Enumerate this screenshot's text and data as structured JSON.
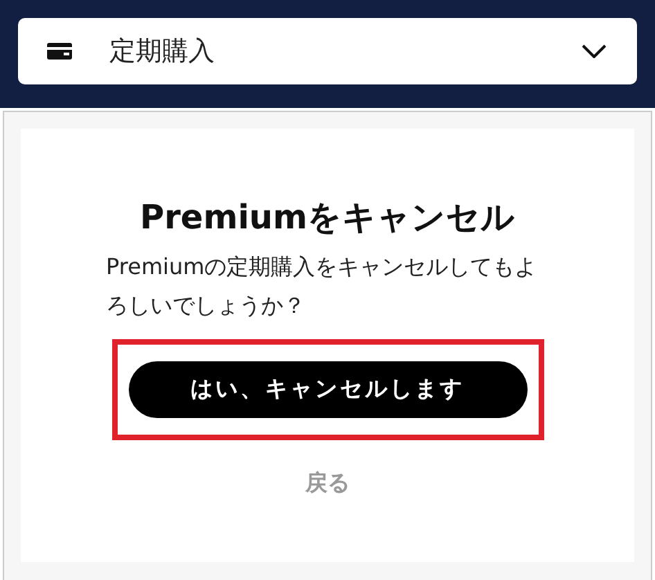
{
  "dropdown": {
    "label": "定期購入",
    "expanded": false
  },
  "dialog": {
    "title": "Premiumをキャンセル",
    "message": "Premiumの定期購入をキャンセルしてもよろしいでしょうか？",
    "confirm_button": {
      "label": "はい、キャンセルします",
      "highlighted": true
    },
    "back_link": "戻る"
  }
}
